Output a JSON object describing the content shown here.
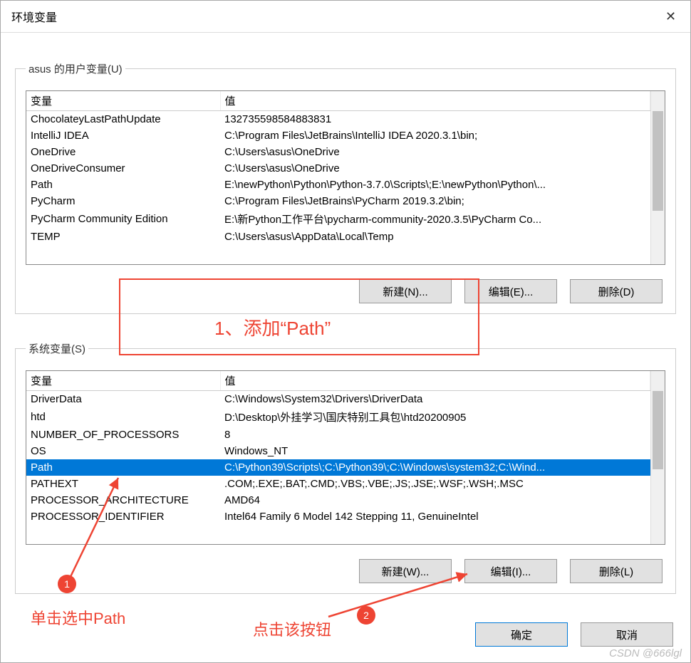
{
  "window": {
    "title": "环境变量"
  },
  "user_section": {
    "legend": "asus 的用户变量(U)",
    "header_var": "变量",
    "header_val": "值",
    "rows": [
      {
        "var": "ChocolateyLastPathUpdate",
        "val": "132735598584883831"
      },
      {
        "var": "IntelliJ IDEA",
        "val": "C:\\Program Files\\JetBrains\\IntelliJ IDEA 2020.3.1\\bin;"
      },
      {
        "var": "OneDrive",
        "val": "C:\\Users\\asus\\OneDrive"
      },
      {
        "var": "OneDriveConsumer",
        "val": "C:\\Users\\asus\\OneDrive"
      },
      {
        "var": "Path",
        "val": "E:\\newPython\\Python\\Python-3.7.0\\Scripts\\;E:\\newPython\\Python\\..."
      },
      {
        "var": "PyCharm",
        "val": "C:\\Program Files\\JetBrains\\PyCharm 2019.3.2\\bin;"
      },
      {
        "var": "PyCharm Community Edition",
        "val": "E:\\新Python工作平台\\pycharm-community-2020.3.5\\PyCharm Co..."
      },
      {
        "var": "TEMP",
        "val": "C:\\Users\\asus\\AppData\\Local\\Temp"
      }
    ],
    "btn_new": "新建(N)...",
    "btn_edit": "编辑(E)...",
    "btn_delete": "删除(D)"
  },
  "system_section": {
    "legend": "系统变量(S)",
    "header_var": "变量",
    "header_val": "值",
    "rows": [
      {
        "var": "DriverData",
        "val": "C:\\Windows\\System32\\Drivers\\DriverData"
      },
      {
        "var": "htd",
        "val": "D:\\Desktop\\外挂学习\\国庆特别工具包\\htd20200905"
      },
      {
        "var": "NUMBER_OF_PROCESSORS",
        "val": "8"
      },
      {
        "var": "OS",
        "val": "Windows_NT"
      },
      {
        "var": "Path",
        "val": "C:\\Python39\\Scripts\\;C:\\Python39\\;C:\\Windows\\system32;C:\\Wind..."
      },
      {
        "var": "PATHEXT",
        "val": ".COM;.EXE;.BAT;.CMD;.VBS;.VBE;.JS;.JSE;.WSF;.WSH;.MSC"
      },
      {
        "var": "PROCESSOR_ARCHITECTURE",
        "val": "AMD64"
      },
      {
        "var": "PROCESSOR_IDENTIFIER",
        "val": "Intel64 Family 6 Model 142 Stepping 11, GenuineIntel"
      }
    ],
    "selected_index": 4,
    "btn_new": "新建(W)...",
    "btn_edit": "编辑(I)...",
    "btn_delete": "删除(L)"
  },
  "dialog": {
    "ok": "确定",
    "cancel": "取消"
  },
  "annotations": {
    "step1_box_label": "1、添加“Path”",
    "badge1": "1",
    "badge2": "2",
    "click_path": "单击选中Path",
    "click_button": "点击该按钮"
  },
  "watermark": "CSDN @666lgl"
}
